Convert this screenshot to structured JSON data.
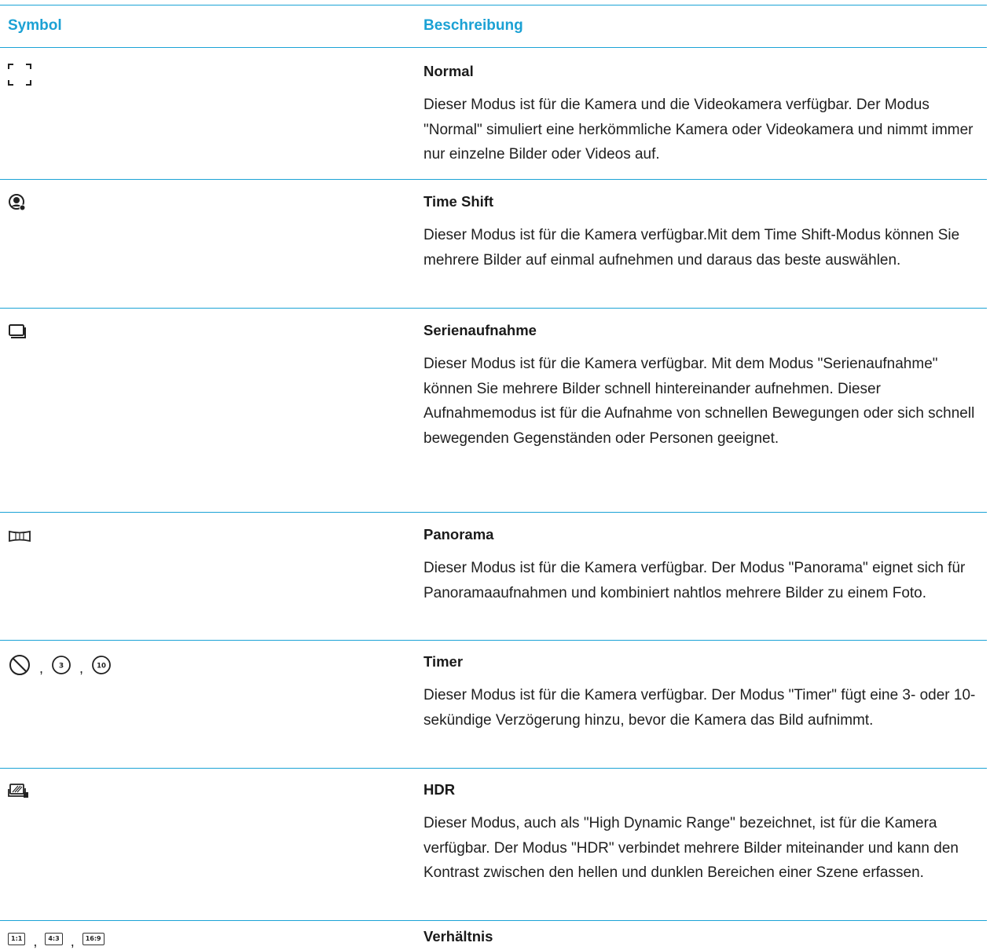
{
  "colors": {
    "accent": "#1ba1d4",
    "rule": "#1ba3d6",
    "text": "#1f1f1f"
  },
  "header": {
    "col_symbol": "Symbol",
    "col_description": "Beschreibung"
  },
  "rows": [
    {
      "icon": "normal-frame-icon",
      "title": "Normal",
      "text": "Dieser Modus ist für die Kamera und die Videokamera verfügbar. Der Modus \"Normal\" simuliert eine herkömmliche Kamera oder Videokamera und nimmt immer nur einzelne Bilder oder Videos auf."
    },
    {
      "icon": "time-shift-icon",
      "title": "Time Shift",
      "text": "Dieser Modus ist für die Kamera verfügbar.Mit dem Time Shift-Modus können Sie mehrere Bilder auf einmal aufnehmen und daraus das beste auswählen."
    },
    {
      "icon": "burst-icon",
      "title": "Serienaufnahme",
      "text": "Dieser Modus ist für die Kamera verfügbar. Mit dem Modus \"Serienaufnahme\" können Sie mehrere Bilder schnell hintereinander aufnehmen. Dieser Aufnahmemodus ist für die Aufnahme von schnellen Bewegungen oder sich schnell bewegenden Gegenständen oder Personen geeignet."
    },
    {
      "icon": "panorama-icon",
      "title": "Panorama",
      "text": "Dieser Modus ist für die Kamera verfügbar. Der Modus \"Panorama\" eignet sich für Panoramaaufnahmen und kombiniert nahtlos mehrere Bilder zu einem Foto."
    },
    {
      "icon": "timer-icons",
      "title": "Timer",
      "text": "Dieser Modus ist für die Kamera verfügbar. Der Modus \"Timer\" fügt eine 3- oder 10-sekündige Verzögerung hinzu, bevor die Kamera das Bild aufnimmt.",
      "timer_labels": [
        "3",
        "10"
      ]
    },
    {
      "icon": "hdr-icon",
      "title": "HDR",
      "text": "Dieser Modus, auch als \"High Dynamic Range\" bezeichnet, ist für die Kamera verfügbar. Der Modus \"HDR\" verbindet mehrere Bilder miteinander und kann den Kontrast zwischen den hellen und dunklen Bereichen einer Szene erfassen."
    },
    {
      "icon": "aspect-ratio-icons",
      "title": "Verhältnis",
      "text": "",
      "ratio_labels": [
        "1:1",
        "4:3",
        "16:9"
      ]
    }
  ],
  "separator": ","
}
